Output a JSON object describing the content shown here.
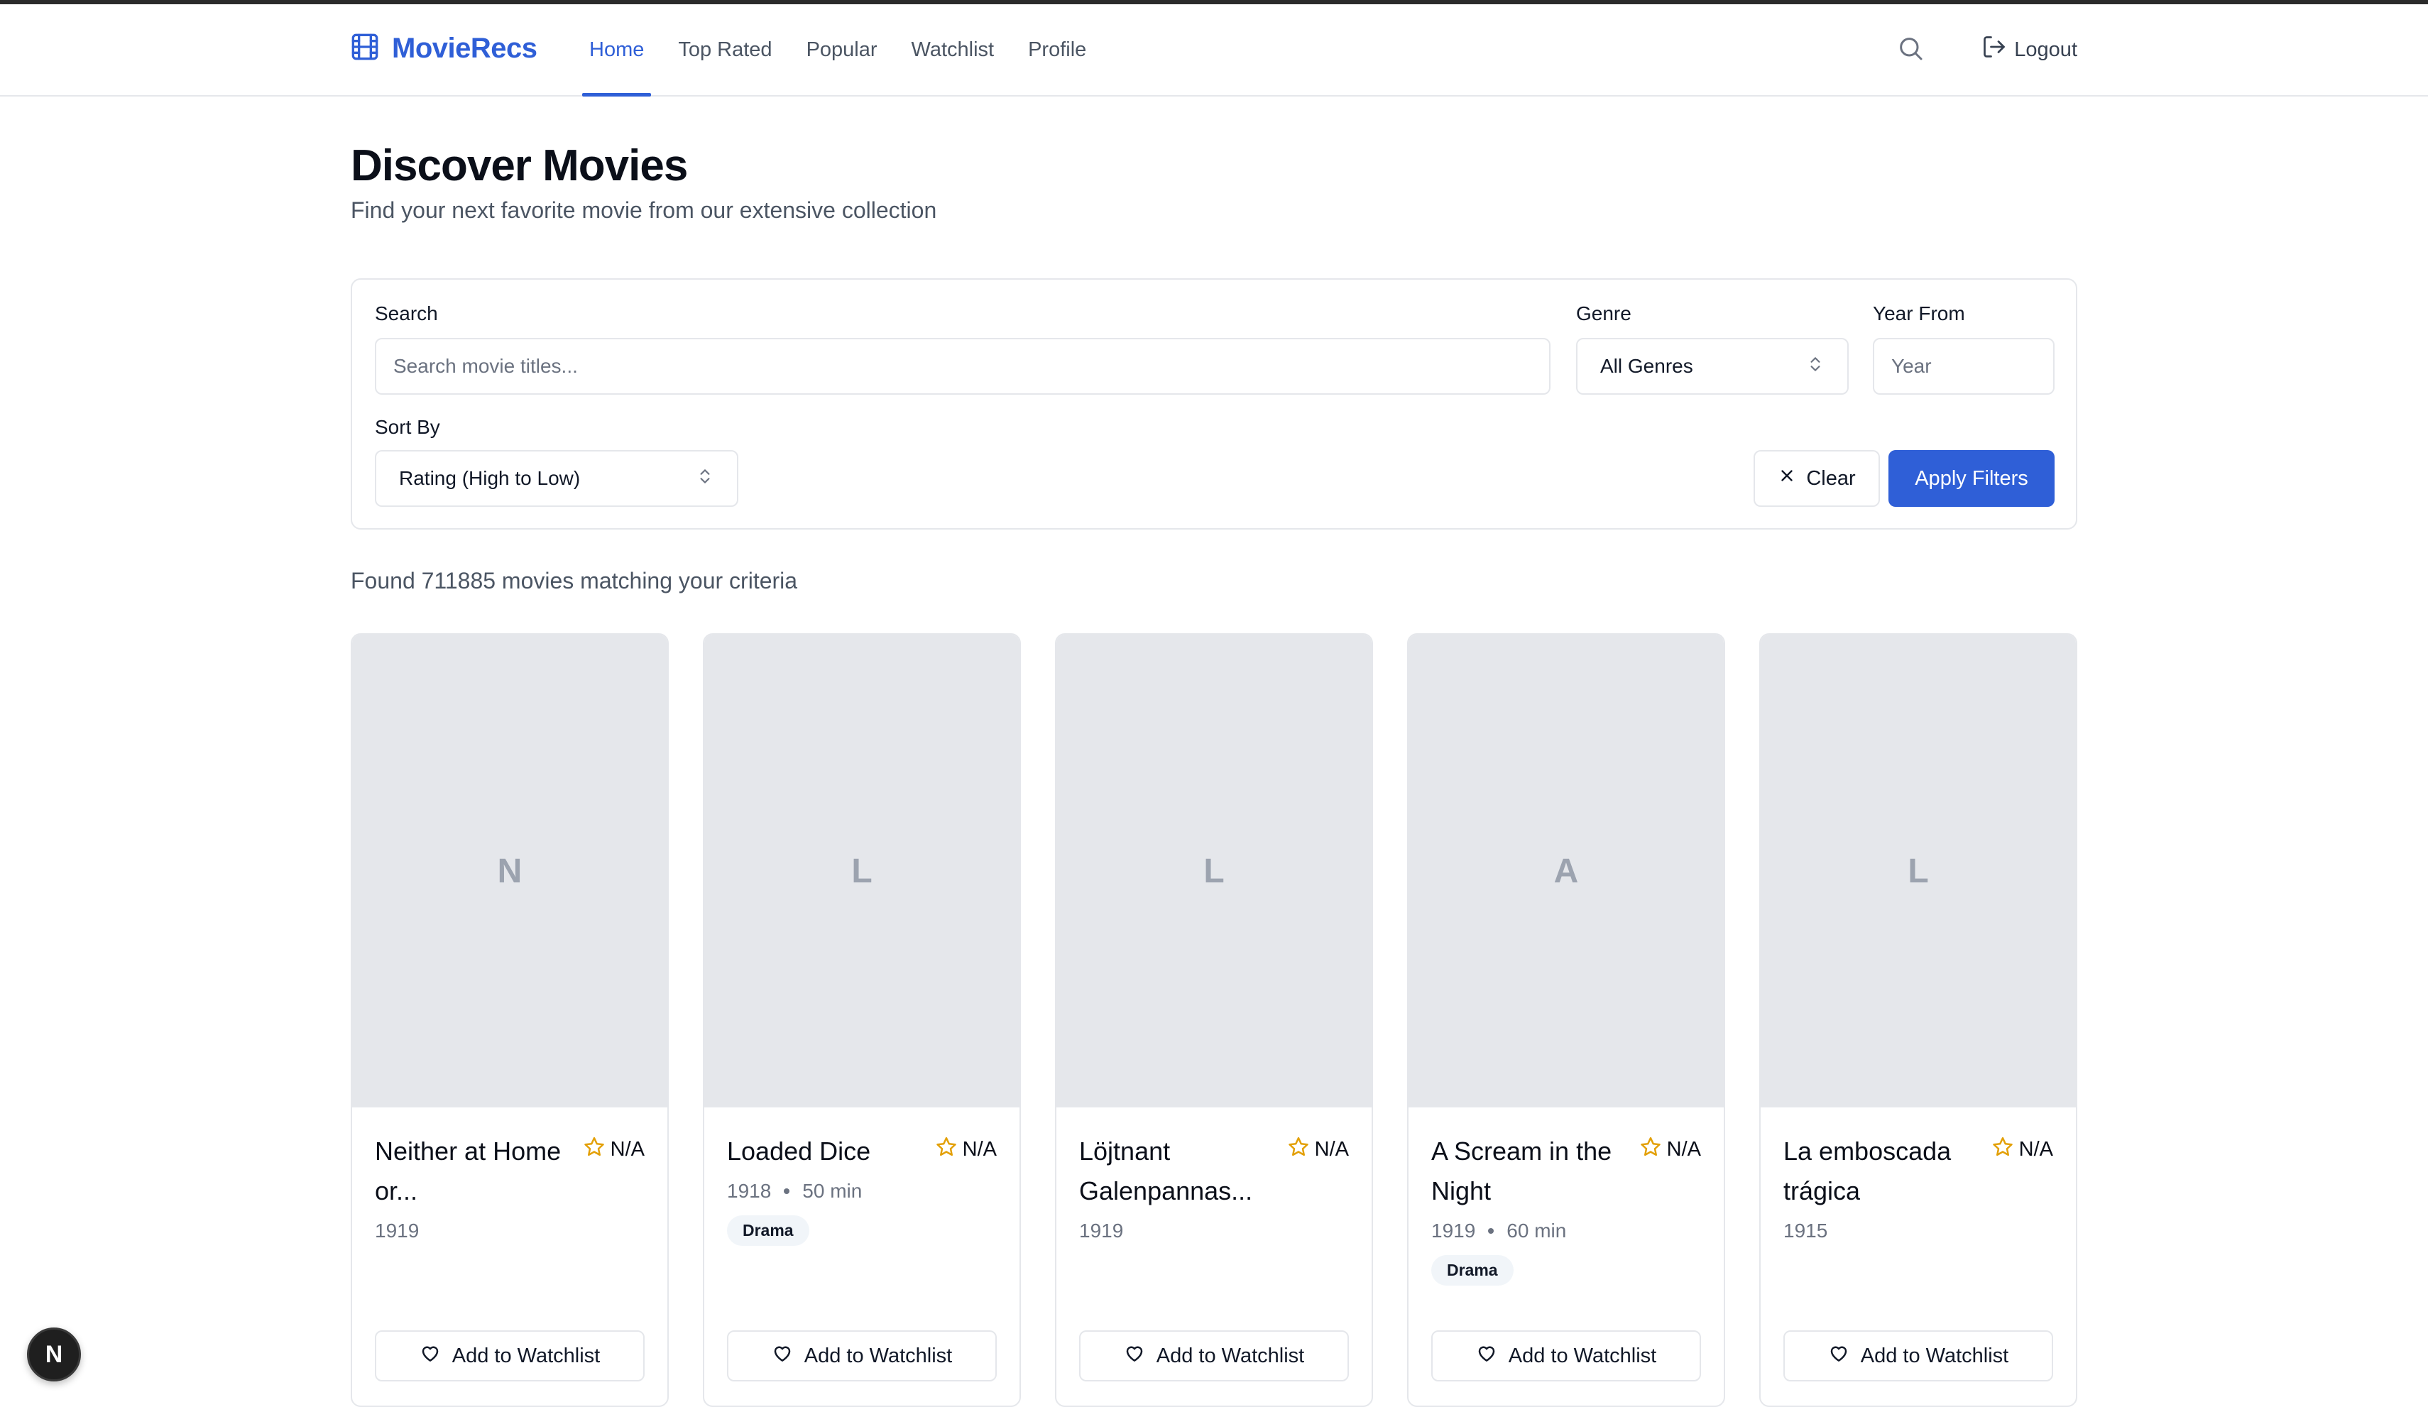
{
  "brand": {
    "name": "MovieRecs",
    "accent": "#2f5fd7"
  },
  "nav": {
    "links": [
      {
        "label": "Home",
        "active": true
      },
      {
        "label": "Top Rated",
        "active": false
      },
      {
        "label": "Popular",
        "active": false
      },
      {
        "label": "Watchlist",
        "active": false
      },
      {
        "label": "Profile",
        "active": false
      }
    ],
    "logout_label": "Logout"
  },
  "page": {
    "title": "Discover Movies",
    "subtitle": "Find your next favorite movie from our extensive collection"
  },
  "filters": {
    "search_label": "Search",
    "search_placeholder": "Search movie titles...",
    "genre_label": "Genre",
    "genre_value": "All Genres",
    "year_label": "Year From",
    "year_placeholder": "Year",
    "sort_label": "Sort By",
    "sort_value": "Rating (High to Low)",
    "clear_label": "Clear",
    "apply_label": "Apply Filters"
  },
  "results": {
    "count_text": "Found 711885 movies matching your criteria"
  },
  "movies": [
    {
      "initial": "N",
      "title": "Neither at Home or...",
      "rating": "N/A",
      "year": "1919",
      "duration": "",
      "genre": "",
      "watch_label": "Add to Watchlist"
    },
    {
      "initial": "L",
      "title": "Loaded Dice",
      "rating": "N/A",
      "year": "1918",
      "duration": "50 min",
      "genre": "Drama",
      "watch_label": "Add to Watchlist"
    },
    {
      "initial": "L",
      "title": "Löjtnant Galenpannas...",
      "rating": "N/A",
      "year": "1919",
      "duration": "",
      "genre": "",
      "watch_label": "Add to Watchlist"
    },
    {
      "initial": "A",
      "title": "A Scream in the Night",
      "rating": "N/A",
      "year": "1919",
      "duration": "60 min",
      "genre": "Drama",
      "watch_label": "Add to Watchlist"
    },
    {
      "initial": "L",
      "title": "La emboscada trágica",
      "rating": "N/A",
      "year": "1915",
      "duration": "",
      "genre": "",
      "watch_label": "Add to Watchlist"
    }
  ],
  "dev_badge": {
    "letter": "N"
  },
  "icons": {
    "logo": "film-icon",
    "search": "search-icon",
    "logout": "logout-icon",
    "chevrons": "chevron-up-down-icon",
    "clear": "close-icon",
    "star": "star-icon",
    "heart": "heart-icon"
  },
  "colors": {
    "star": "#e3a008",
    "apply_button": "#2f5fd7",
    "poster_bg": "#e5e7eb"
  }
}
